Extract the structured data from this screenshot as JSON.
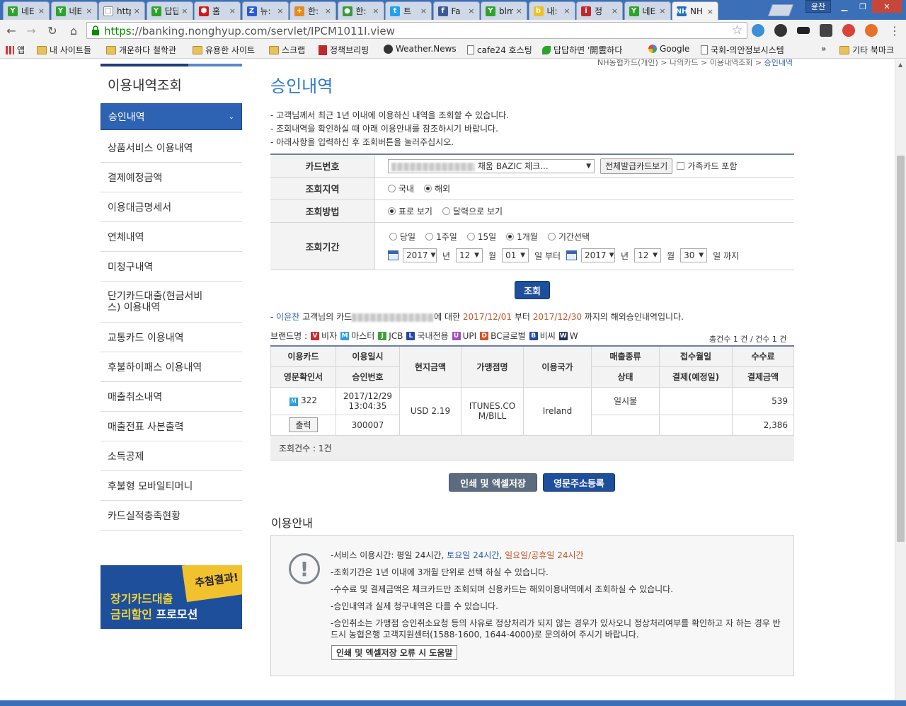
{
  "browser": {
    "tabs": [
      {
        "label": "네E",
        "fav": "#2aa52a",
        "glyph": "Y"
      },
      {
        "label": "네E",
        "fav": "#2aa52a",
        "glyph": "Y"
      },
      {
        "label": "http",
        "fav": "#ffffff",
        "glyph": "□"
      },
      {
        "label": "답답",
        "fav": "#2aa52a",
        "glyph": "Y"
      },
      {
        "label": "홈",
        "fav": "#d11a1a",
        "glyph": "⬢"
      },
      {
        "label": "뉴:",
        "fav": "#2a5bd7",
        "glyph": "Z"
      },
      {
        "label": "한:",
        "fav": "#e58a1f",
        "glyph": "+"
      },
      {
        "label": "한:",
        "fav": "#3a9a3a",
        "glyph": "●"
      },
      {
        "label": "트",
        "fav": "#1da1f2",
        "glyph": "t"
      },
      {
        "label": "Fa",
        "fav": "#3b5998",
        "glyph": "f"
      },
      {
        "label": "blm",
        "fav": "#2aa52a",
        "glyph": "Y"
      },
      {
        "label": "내:",
        "fav": "#f0c020",
        "glyph": "b"
      },
      {
        "label": "정",
        "fav": "#c0282e",
        "glyph": "i"
      },
      {
        "label": "네E",
        "fav": "#2aa52a",
        "glyph": "Y"
      },
      {
        "label": "NH",
        "fav": "#1e6fc4",
        "glyph": "NH"
      }
    ],
    "user_label": "윤찬",
    "url_scheme": "https",
    "url_rest": "://banking.nonghyup.com/servlet/IPCM1011I.view",
    "bookmarks": [
      "앱",
      "내 사이트들",
      "개운하다 철학관",
      "유용한 사이트",
      "스크랩",
      "정책브리핑",
      "Weather.News",
      "cafe24 호스팅",
      "답답하면 '開雲하다",
      "Google",
      "국회-의안정보시스템",
      "기타 북마크"
    ],
    "bookmark_more": "»"
  },
  "sidebar": {
    "title": "이용내역조회",
    "items": [
      "승인내역",
      "상품서비스 이용내역",
      "결제예정금액",
      "이용대금명세서",
      "연체내역",
      "미청구내역",
      "단기카드대출(현금서비스) 이용내역",
      "교통카드 이용내역",
      "후불하이패스 이용내역",
      "매출취소내역",
      "매출전표 사본출력",
      "소득공제",
      "후불형 모바일티머니",
      "카드실적충족현황"
    ],
    "banner": {
      "tag": "추첨결과!",
      "line1": "장기카드대출",
      "line2a": "금리할인",
      "line2b": " 프로모션"
    }
  },
  "breadcrumb": {
    "path": "NH농협카드(개인) > 나의카드 > 이용내역조회 > ",
    "current": "승인내역"
  },
  "page_title": "승인내역",
  "notes": [
    "- 고객님께서 최근 1년 이내에 이용하신 내역을 조회할 수 있습니다.",
    "- 조회내역을 확인하실 때 아래 이용안내를 참조하시기 바랍니다.",
    "- 아래사항을 입력하신 후 조회버튼을 눌러주십시오."
  ],
  "form": {
    "card_label": "카드번호",
    "card_value": "채움 BAZIC 체크...",
    "all_cards_btn": "전체발급카드보기",
    "family_chk": "가족카드 포함",
    "region_label": "조회지역",
    "region_opts": [
      "국내",
      "해외"
    ],
    "method_label": "조회방법",
    "method_opts": [
      "표로 보기",
      "달력으로 보기"
    ],
    "period_label": "조회기간",
    "period_opts": [
      "당일",
      "1주일",
      "15일",
      "1개월",
      "기간선택"
    ],
    "from": {
      "year": "2017",
      "month": "12",
      "day": "01"
    },
    "to": {
      "year": "2017",
      "month": "12",
      "day": "30"
    },
    "u_year": "년",
    "u_month": "월",
    "u_from": "일 부터",
    "u_to": "일 까지",
    "search_btn": "조회"
  },
  "result": {
    "customer": "이윤찬",
    "text1": " 고객님의 카드",
    "text2": "에 대한 ",
    "date_from": "2017/12/01",
    "text3": " 부터 ",
    "date_to": "2017/12/30",
    "text4": " 까지의 해외승인내역입니다.",
    "brand_label": "브랜드명 :",
    "brands": [
      {
        "code": "V",
        "name": "비자",
        "color": "#d4242a"
      },
      {
        "code": "M",
        "name": "마스터",
        "color": "#2aa0de"
      },
      {
        "code": "J",
        "name": "JCB",
        "color": "#3aa33a"
      },
      {
        "code": "L",
        "name": "국내전용",
        "color": "#2647a8"
      },
      {
        "code": "U",
        "name": "UPI",
        "color": "#a14fc0"
      },
      {
        "code": "D",
        "name": "BC글로벌",
        "color": "#d4542a"
      },
      {
        "code": "B",
        "name": "비씨",
        "color": "#2647a8"
      },
      {
        "code": "W",
        "name": "W",
        "color": "#1f2f5f"
      }
    ],
    "count_text": "총건수 1 건 / 건수 1 건"
  },
  "table": {
    "headers": {
      "h1a": "이용카드",
      "h1b": "영문확인서",
      "h2a": "이용일시",
      "h2b": "승인번호",
      "h3": "현지금액",
      "h4": "가맹점명",
      "h5": "이용국가",
      "h6a": "매출종류",
      "h6b": "상태",
      "h7a": "접수월일",
      "h7b": "결제(예정일)",
      "h8a": "수수료",
      "h8b": "결제금액"
    },
    "row": {
      "brand": "M",
      "card": "322",
      "date": "2017/12/29",
      "time": "13:04:35",
      "print_btn": "출력",
      "approval": "300007",
      "amount": "USD 2.19",
      "merchant": "ITUNES.CO M/BILL",
      "country": "Ireland",
      "sale_type": "일시불",
      "status": "",
      "received": "",
      "settle_date": "",
      "fee": "539",
      "pay_amount": "2,386"
    },
    "summary": "조회건수 : 1건"
  },
  "actions": {
    "print_excel": "인쇄 및 엑셀저장",
    "eng_addr": "영문주소등록"
  },
  "guide": {
    "title": "이용안내",
    "s1a": "-서비스 이용시간: 평일 24시간, ",
    "s1b": "토요일 24시간",
    "s1c": ", ",
    "s1d": "일요일/공휴일 24시간",
    "items": [
      "-조회기간은 1년 이내에 3개월 단위로 선택 하실 수 있습니다.",
      "-수수료 및 결제금액은 체크카드만 조회되며 신용카드는 해외이용내역에서 조회하실 수 있습니다.",
      "-승인내역과 실제 청구내역은 다를 수 있습니다.",
      "-승인취소는 가맹점 승인취소요청 등의 사유로 정상처리가 되지 않는 경우가 있사오니 정상처리여부를 확인하고 자 하는 경우 반드시 농협은행 고객지원센터(1588-1600, 1644-4000)로 문의하여 주시기 바랍니다."
    ],
    "help_btn": "인쇄 및 엑셀저장 오류 시 도움말"
  }
}
